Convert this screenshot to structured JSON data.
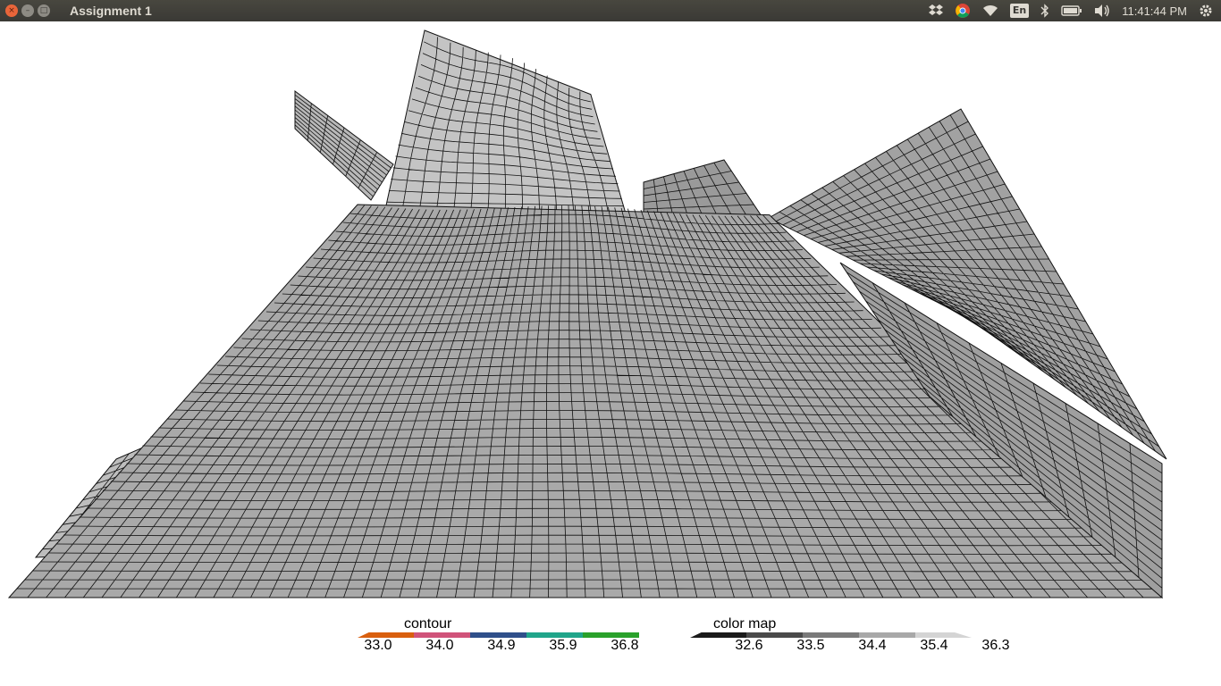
{
  "window": {
    "title": "Assignment 1",
    "controls": {
      "close": "×",
      "minimize": "–",
      "maximize": "□"
    }
  },
  "panel": {
    "lang": "En",
    "clock": "11:41:44 PM",
    "icons": [
      "dropbox-icon",
      "chrome-icon",
      "wifi-icon",
      "keyboard-layout-icon",
      "bluetooth-icon",
      "battery-icon",
      "volume-icon",
      "gear-icon"
    ]
  },
  "legends": {
    "contour": {
      "title": "contour",
      "ticks": [
        "33.0",
        "34.0",
        "34.9",
        "35.9",
        "36.8"
      ],
      "colors": [
        "#d95f0e",
        "#d0537a",
        "#2f4f8a",
        "#20a58a",
        "#2aa12b"
      ]
    },
    "colormap": {
      "title": "color map",
      "ticks": [
        "32.6",
        "33.5",
        "34.4",
        "35.4",
        "36.3"
      ],
      "colors": [
        "#1a1a1a",
        "#4a4a4a",
        "#7a7a7a",
        "#a8a8a8",
        "#d4d4d4"
      ]
    }
  },
  "surface": {
    "fill": "#a9a9a9",
    "grid": "#111111"
  }
}
